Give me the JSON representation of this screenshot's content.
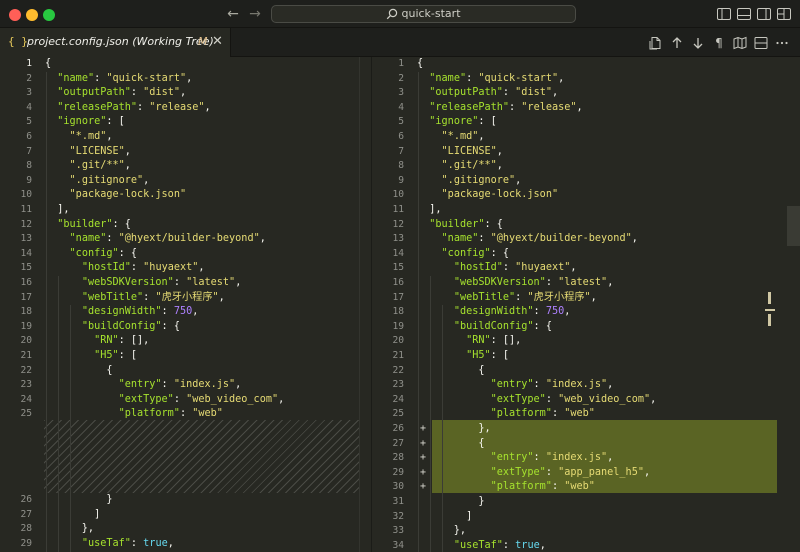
{
  "titlebar": {
    "search_text": "quick-start",
    "nav_back": "←",
    "nav_forward": "→"
  },
  "tab": {
    "icon_text": "{ }",
    "label": "project.config.json (Working Tree)",
    "modified_marker": "M",
    "close_glyph": "✕"
  },
  "editor_actions": {
    "pilcrow": "¶"
  },
  "left_pane": {
    "lines": [
      {
        "n": "1",
        "tokens": [
          [
            "p",
            "{"
          ]
        ]
      },
      {
        "n": "2",
        "tokens": [
          [
            "p",
            "  "
          ],
          [
            "k",
            "\"name\""
          ],
          [
            "p",
            ": "
          ],
          [
            "s",
            "\"quick-start\""
          ],
          [
            "p",
            ","
          ]
        ]
      },
      {
        "n": "3",
        "tokens": [
          [
            "p",
            "  "
          ],
          [
            "k",
            "\"outputPath\""
          ],
          [
            "p",
            ": "
          ],
          [
            "s",
            "\"dist\""
          ],
          [
            "p",
            ","
          ]
        ]
      },
      {
        "n": "4",
        "tokens": [
          [
            "p",
            "  "
          ],
          [
            "k",
            "\"releasePath\""
          ],
          [
            "p",
            ": "
          ],
          [
            "s",
            "\"release\""
          ],
          [
            "p",
            ","
          ]
        ]
      },
      {
        "n": "5",
        "tokens": [
          [
            "p",
            "  "
          ],
          [
            "k",
            "\"ignore\""
          ],
          [
            "p",
            ": ["
          ]
        ]
      },
      {
        "n": "6",
        "tokens": [
          [
            "p",
            "    "
          ],
          [
            "s",
            "\"*.md\""
          ],
          [
            "p",
            ","
          ]
        ]
      },
      {
        "n": "7",
        "tokens": [
          [
            "p",
            "    "
          ],
          [
            "s",
            "\"LICENSE\""
          ],
          [
            "p",
            ","
          ]
        ]
      },
      {
        "n": "8",
        "tokens": [
          [
            "p",
            "    "
          ],
          [
            "s",
            "\".git/**\""
          ],
          [
            "p",
            ","
          ]
        ]
      },
      {
        "n": "9",
        "tokens": [
          [
            "p",
            "    "
          ],
          [
            "s",
            "\".gitignore\""
          ],
          [
            "p",
            ","
          ]
        ]
      },
      {
        "n": "10",
        "tokens": [
          [
            "p",
            "    "
          ],
          [
            "s",
            "\"package-lock.json\""
          ]
        ]
      },
      {
        "n": "11",
        "tokens": [
          [
            "p",
            "  ],"
          ]
        ]
      },
      {
        "n": "12",
        "tokens": [
          [
            "p",
            "  "
          ],
          [
            "k",
            "\"builder\""
          ],
          [
            "p",
            ": {"
          ]
        ]
      },
      {
        "n": "13",
        "tokens": [
          [
            "p",
            "    "
          ],
          [
            "k",
            "\"name\""
          ],
          [
            "p",
            ": "
          ],
          [
            "s",
            "\"@hyext/builder-beyond\""
          ],
          [
            "p",
            ","
          ]
        ]
      },
      {
        "n": "14",
        "tokens": [
          [
            "p",
            "    "
          ],
          [
            "k",
            "\"config\""
          ],
          [
            "p",
            ": {"
          ]
        ]
      },
      {
        "n": "15",
        "tokens": [
          [
            "p",
            "      "
          ],
          [
            "k",
            "\"hostId\""
          ],
          [
            "p",
            ": "
          ],
          [
            "s",
            "\"huyaext\""
          ],
          [
            "p",
            ","
          ]
        ]
      },
      {
        "n": "16",
        "tokens": [
          [
            "p",
            "      "
          ],
          [
            "k",
            "\"webSDKVersion\""
          ],
          [
            "p",
            ": "
          ],
          [
            "s",
            "\"latest\""
          ],
          [
            "p",
            ","
          ]
        ]
      },
      {
        "n": "17",
        "tokens": [
          [
            "p",
            "      "
          ],
          [
            "k",
            "\"webTitle\""
          ],
          [
            "p",
            ": "
          ],
          [
            "s",
            "\"虎牙小程序\""
          ],
          [
            "p",
            ","
          ]
        ]
      },
      {
        "n": "18",
        "tokens": [
          [
            "p",
            "      "
          ],
          [
            "k",
            "\"designWidth\""
          ],
          [
            "p",
            ": "
          ],
          [
            "n",
            "750"
          ],
          [
            "p",
            ","
          ]
        ]
      },
      {
        "n": "19",
        "tokens": [
          [
            "p",
            "      "
          ],
          [
            "k",
            "\"buildConfig\""
          ],
          [
            "p",
            ": {"
          ]
        ]
      },
      {
        "n": "20",
        "tokens": [
          [
            "p",
            "        "
          ],
          [
            "k",
            "\"RN\""
          ],
          [
            "p",
            ": [],"
          ]
        ]
      },
      {
        "n": "21",
        "tokens": [
          [
            "p",
            "        "
          ],
          [
            "k",
            "\"H5\""
          ],
          [
            "p",
            ": ["
          ]
        ]
      },
      {
        "n": "22",
        "tokens": [
          [
            "p",
            "          {"
          ]
        ]
      },
      {
        "n": "23",
        "tokens": [
          [
            "p",
            "            "
          ],
          [
            "k",
            "\"entry\""
          ],
          [
            "p",
            ": "
          ],
          [
            "s",
            "\"index.js\""
          ],
          [
            "p",
            ","
          ]
        ]
      },
      {
        "n": "24",
        "tokens": [
          [
            "p",
            "            "
          ],
          [
            "k",
            "\"extType\""
          ],
          [
            "p",
            ": "
          ],
          [
            "s",
            "\"web_video_com\""
          ],
          [
            "p",
            ","
          ]
        ]
      },
      {
        "n": "25",
        "tokens": [
          [
            "p",
            "            "
          ],
          [
            "k",
            "\"platform\""
          ],
          [
            "p",
            ": "
          ],
          [
            "s",
            "\"web\""
          ]
        ]
      }
    ],
    "lines_after": [
      {
        "n": "26",
        "tokens": [
          [
            "p",
            "          }"
          ]
        ]
      },
      {
        "n": "27",
        "tokens": [
          [
            "p",
            "        ]"
          ]
        ]
      },
      {
        "n": "28",
        "tokens": [
          [
            "p",
            "      },"
          ]
        ]
      },
      {
        "n": "29",
        "tokens": [
          [
            "p",
            "      "
          ],
          [
            "k",
            "\"useTaf\""
          ],
          [
            "p",
            ": "
          ],
          [
            "kw",
            "true"
          ],
          [
            "p",
            ","
          ]
        ]
      }
    ]
  },
  "right_pane": {
    "lines": [
      {
        "n": "1",
        "tokens": [
          [
            "p",
            "{"
          ]
        ]
      },
      {
        "n": "2",
        "tokens": [
          [
            "p",
            "  "
          ],
          [
            "k",
            "\"name\""
          ],
          [
            "p",
            ": "
          ],
          [
            "s",
            "\"quick-start\""
          ],
          [
            "p",
            ","
          ]
        ]
      },
      {
        "n": "3",
        "tokens": [
          [
            "p",
            "  "
          ],
          [
            "k",
            "\"outputPath\""
          ],
          [
            "p",
            ": "
          ],
          [
            "s",
            "\"dist\""
          ],
          [
            "p",
            ","
          ]
        ]
      },
      {
        "n": "4",
        "tokens": [
          [
            "p",
            "  "
          ],
          [
            "k",
            "\"releasePath\""
          ],
          [
            "p",
            ": "
          ],
          [
            "s",
            "\"release\""
          ],
          [
            "p",
            ","
          ]
        ]
      },
      {
        "n": "5",
        "tokens": [
          [
            "p",
            "  "
          ],
          [
            "k",
            "\"ignore\""
          ],
          [
            "p",
            ": ["
          ]
        ]
      },
      {
        "n": "6",
        "tokens": [
          [
            "p",
            "    "
          ],
          [
            "s",
            "\"*.md\""
          ],
          [
            "p",
            ","
          ]
        ]
      },
      {
        "n": "7",
        "tokens": [
          [
            "p",
            "    "
          ],
          [
            "s",
            "\"LICENSE\""
          ],
          [
            "p",
            ","
          ]
        ]
      },
      {
        "n": "8",
        "tokens": [
          [
            "p",
            "    "
          ],
          [
            "s",
            "\".git/**\""
          ],
          [
            "p",
            ","
          ]
        ]
      },
      {
        "n": "9",
        "tokens": [
          [
            "p",
            "    "
          ],
          [
            "s",
            "\".gitignore\""
          ],
          [
            "p",
            ","
          ]
        ]
      },
      {
        "n": "10",
        "tokens": [
          [
            "p",
            "    "
          ],
          [
            "s",
            "\"package-lock.json\""
          ]
        ]
      },
      {
        "n": "11",
        "tokens": [
          [
            "p",
            "  ],"
          ]
        ]
      },
      {
        "n": "12",
        "tokens": [
          [
            "p",
            "  "
          ],
          [
            "k",
            "\"builder\""
          ],
          [
            "p",
            ": {"
          ]
        ]
      },
      {
        "n": "13",
        "tokens": [
          [
            "p",
            "    "
          ],
          [
            "k",
            "\"name\""
          ],
          [
            "p",
            ": "
          ],
          [
            "s",
            "\"@hyext/builder-beyond\""
          ],
          [
            "p",
            ","
          ]
        ]
      },
      {
        "n": "14",
        "tokens": [
          [
            "p",
            "    "
          ],
          [
            "k",
            "\"config\""
          ],
          [
            "p",
            ": "
          ],
          [
            "p",
            "{"
          ]
        ]
      },
      {
        "n": "15",
        "tokens": [
          [
            "p",
            "      "
          ],
          [
            "k",
            "\"hostId\""
          ],
          [
            "p",
            ": "
          ],
          [
            "s",
            "\"huyaext\""
          ],
          [
            "p",
            ","
          ]
        ]
      },
      {
        "n": "16",
        "tokens": [
          [
            "p",
            "      "
          ],
          [
            "k",
            "\"webSDKVersion\""
          ],
          [
            "p",
            ": "
          ],
          [
            "s",
            "\"latest\""
          ],
          [
            "p",
            ","
          ]
        ]
      },
      {
        "n": "17",
        "tokens": [
          [
            "p",
            "      "
          ],
          [
            "k",
            "\"webTitle\""
          ],
          [
            "p",
            ": "
          ],
          [
            "s",
            "\"虎牙小程序\""
          ],
          [
            "p",
            ","
          ]
        ]
      },
      {
        "n": "18",
        "tokens": [
          [
            "p",
            "      "
          ],
          [
            "k",
            "\"designWidth\""
          ],
          [
            "p",
            ": "
          ],
          [
            "n",
            "750"
          ],
          [
            "p",
            ","
          ]
        ]
      },
      {
        "n": "19",
        "tokens": [
          [
            "p",
            "      "
          ],
          [
            "k",
            "\"buildConfig\""
          ],
          [
            "p",
            ": {"
          ]
        ]
      },
      {
        "n": "20",
        "tokens": [
          [
            "p",
            "        "
          ],
          [
            "k",
            "\"RN\""
          ],
          [
            "p",
            ": [],"
          ]
        ]
      },
      {
        "n": "21",
        "tokens": [
          [
            "p",
            "        "
          ],
          [
            "k",
            "\"H5\""
          ],
          [
            "p",
            ": ["
          ]
        ]
      },
      {
        "n": "22",
        "tokens": [
          [
            "p",
            "          {"
          ]
        ]
      },
      {
        "n": "23",
        "tokens": [
          [
            "p",
            "            "
          ],
          [
            "k",
            "\"entry\""
          ],
          [
            "p",
            ": "
          ],
          [
            "s",
            "\"index.js\""
          ],
          [
            "p",
            ","
          ]
        ]
      },
      {
        "n": "24",
        "tokens": [
          [
            "p",
            "            "
          ],
          [
            "k",
            "\"extType\""
          ],
          [
            "p",
            ": "
          ],
          [
            "s",
            "\"web_video_com\""
          ],
          [
            "p",
            ","
          ]
        ]
      },
      {
        "n": "25",
        "tokens": [
          [
            "p",
            "            "
          ],
          [
            "k",
            "\"platform\""
          ],
          [
            "p",
            ": "
          ],
          [
            "s",
            "\"web\""
          ]
        ]
      },
      {
        "n": "26",
        "added": true,
        "tokens": [
          [
            "p",
            "          },"
          ]
        ]
      },
      {
        "n": "27",
        "added": true,
        "tokens": [
          [
            "p",
            "          {"
          ]
        ]
      },
      {
        "n": "28",
        "added": true,
        "tokens": [
          [
            "p",
            "            "
          ],
          [
            "k",
            "\"entry\""
          ],
          [
            "p",
            ": "
          ],
          [
            "s",
            "\"index.js\""
          ],
          [
            "p",
            ","
          ]
        ]
      },
      {
        "n": "29",
        "added": true,
        "tokens": [
          [
            "p",
            "            "
          ],
          [
            "k",
            "\"extType\""
          ],
          [
            "p",
            ": "
          ],
          [
            "s",
            "\"app_panel_h5\""
          ],
          [
            "p",
            ","
          ]
        ]
      },
      {
        "n": "30",
        "added": true,
        "tokens": [
          [
            "p",
            "            "
          ],
          [
            "k",
            "\"platform\""
          ],
          [
            "p",
            ": "
          ],
          [
            "s",
            "\"web\""
          ]
        ]
      },
      {
        "n": "31",
        "tokens": [
          [
            "p",
            "          }"
          ]
        ]
      },
      {
        "n": "32",
        "tokens": [
          [
            "p",
            "        ]"
          ]
        ]
      },
      {
        "n": "33",
        "tokens": [
          [
            "p",
            "      },"
          ]
        ]
      },
      {
        "n": "34",
        "tokens": [
          [
            "p",
            "      "
          ],
          [
            "k",
            "\"useTaf\""
          ],
          [
            "p",
            ": "
          ],
          [
            "kw",
            "true"
          ],
          [
            "p",
            ","
          ]
        ]
      }
    ],
    "added_marker": "+"
  },
  "colors": {
    "key": "#a6e22e",
    "string": "#e6db74",
    "number": "#ae81ff",
    "keyword": "#66d9ef",
    "added_bg": "#5a6424"
  }
}
